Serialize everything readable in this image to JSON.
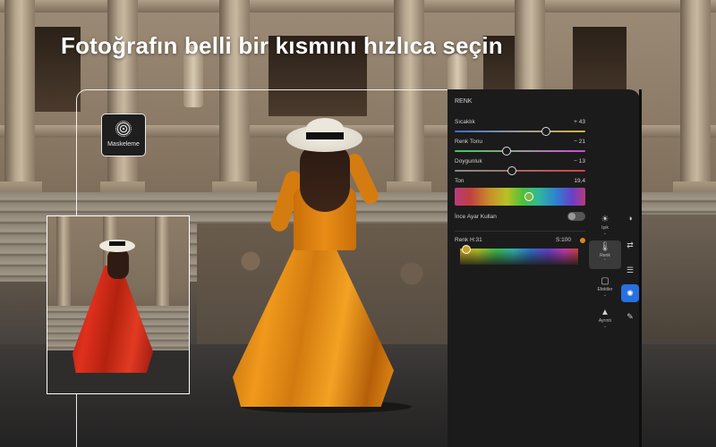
{
  "headline": "Fotoğrafın belli bir kısmını hızlıca seçin",
  "mask_tool": {
    "label": "Maskeleme",
    "icon": "mask-icon"
  },
  "panel": {
    "title": "RENK",
    "sliders": [
      {
        "label": "Sıcaklık",
        "value": "+ 43",
        "position": 0.7
      },
      {
        "label": "Renk Tonu",
        "value": "− 21",
        "position": 0.4
      },
      {
        "label": "Doygunluk",
        "value": "− 13",
        "position": 0.44
      }
    ],
    "tone": {
      "label": "Ton",
      "value": "19,4",
      "position": 0.57
    },
    "fine_adjust": {
      "label": "İnce Ayar Kullan",
      "enabled": false
    },
    "color_picker": {
      "label": "Renk",
      "hue": "H:31",
      "saturation": "S:100",
      "swatch": "#e0841a"
    }
  },
  "tools": [
    {
      "label": "Işık",
      "icon": "sun-icon",
      "glyph": "☀"
    },
    {
      "label": "Renk",
      "icon": "thermometer-icon",
      "glyph": "🌡",
      "active": true
    },
    {
      "label": "Efektler",
      "icon": "effects-icon",
      "glyph": "▢"
    },
    {
      "label": "Ayrıntı",
      "icon": "detail-icon",
      "glyph": "▲"
    }
  ],
  "strip_icons": [
    {
      "icon": "circles-icon",
      "glyph": "◑"
    },
    {
      "icon": "transform-icon",
      "glyph": "⇄"
    },
    {
      "icon": "sliders-icon",
      "glyph": "☰"
    },
    {
      "icon": "masking-icon",
      "glyph": "✺",
      "active": true
    },
    {
      "icon": "healing-icon",
      "glyph": "✎"
    }
  ],
  "colors": {
    "accent": "#2a6fe0",
    "panel_bg": "#1b1b1b",
    "dress": "#e88c16"
  }
}
